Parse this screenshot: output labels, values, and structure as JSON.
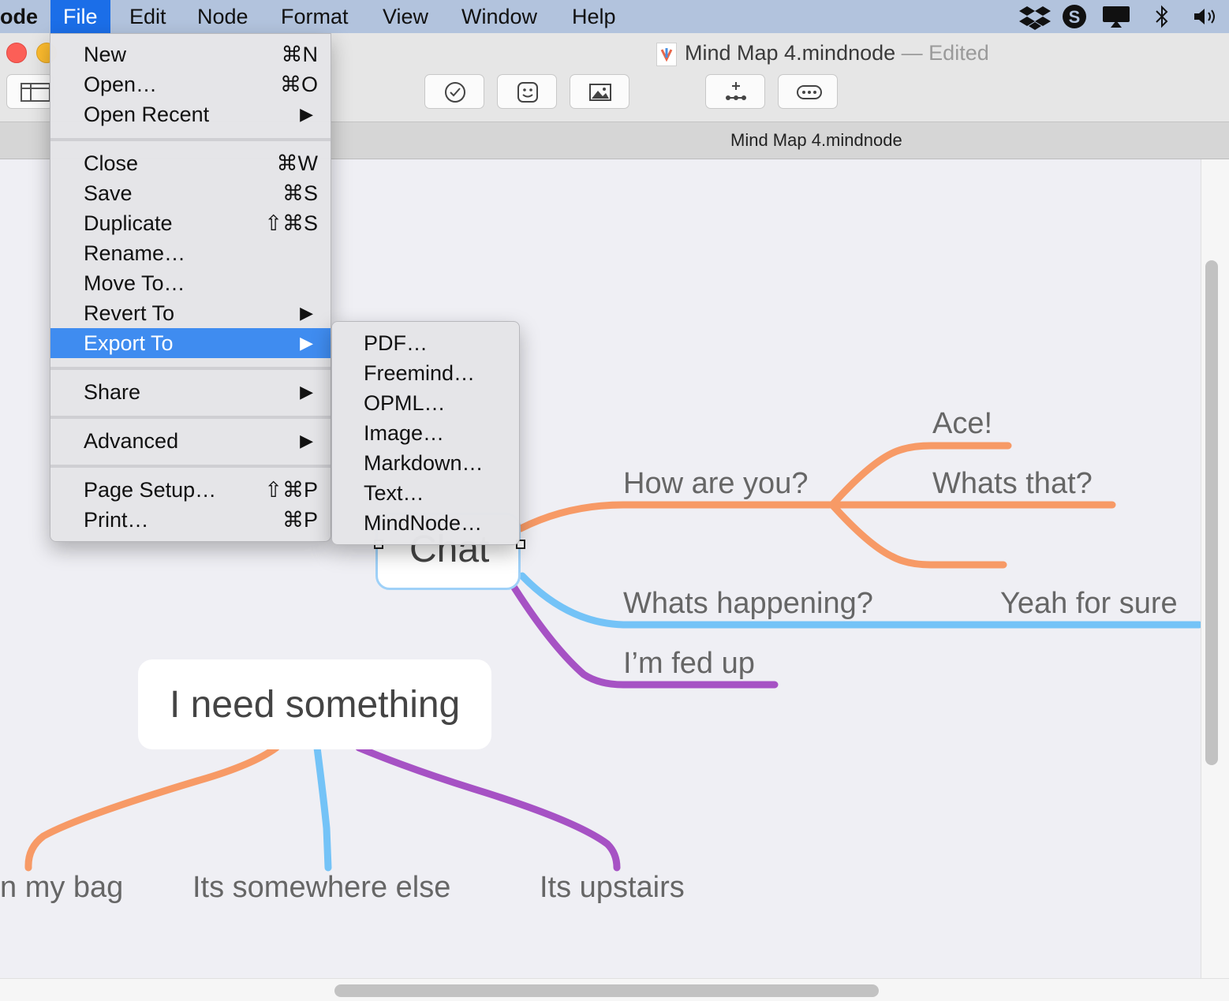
{
  "menubar": {
    "app_name": "ode",
    "items": [
      "File",
      "Edit",
      "Node",
      "Format",
      "View",
      "Window",
      "Help"
    ],
    "active": "File",
    "tray_icons": [
      "dropbox-icon",
      "skype-icon",
      "airplay-icon",
      "bluetooth-icon",
      "volume-icon"
    ]
  },
  "window": {
    "title": "Mind Map 4.mindnode",
    "title_suffix": "— Edited",
    "tab_title": "Mind Map 4.mindnode",
    "toolbar_icons": [
      "sidebar-icon",
      "task-check-icon",
      "sticker-icon",
      "image-icon",
      "add-node-icon",
      "more-icon"
    ]
  },
  "file_menu": {
    "items": [
      {
        "label": "New",
        "shortcut": "⌘N"
      },
      {
        "label": "Open…",
        "shortcut": "⌘O"
      },
      {
        "label": "Open Recent",
        "submenu": true
      },
      {
        "label": "Close",
        "shortcut": "⌘W"
      },
      {
        "label": "Save",
        "shortcut": "⌘S"
      },
      {
        "label": "Duplicate",
        "shortcut": "⇧⌘S"
      },
      {
        "label": "Rename…"
      },
      {
        "label": "Move To…"
      },
      {
        "label": "Revert To",
        "submenu": true
      },
      {
        "label": "Export To",
        "submenu": true,
        "highlighted": true
      },
      {
        "label": "Share",
        "submenu": true
      },
      {
        "label": "Advanced",
        "submenu": true
      },
      {
        "label": "Page Setup…",
        "shortcut": "⇧⌘P"
      },
      {
        "label": "Print…",
        "shortcut": "⌘P"
      }
    ],
    "arrow": "▶"
  },
  "export_submenu": {
    "items": [
      "PDF…",
      "Freemind…",
      "OPML…",
      "Image…",
      "Markdown…",
      "Text…",
      "MindNode…"
    ]
  },
  "mindmap": {
    "center_node": "Chat",
    "branches": [
      "How are you?",
      "Whats happening?",
      "I’m fed up"
    ],
    "sub_branches": [
      "Ace!",
      "Whats that?",
      "Yeah for sure"
    ],
    "second_node": "I need something",
    "second_branches": [
      "n my bag",
      "Its somewhere else",
      "Its upstairs"
    ],
    "colors": {
      "orange": "#f79a66",
      "blue": "#74c3f7",
      "purple": "#a652c4"
    }
  }
}
